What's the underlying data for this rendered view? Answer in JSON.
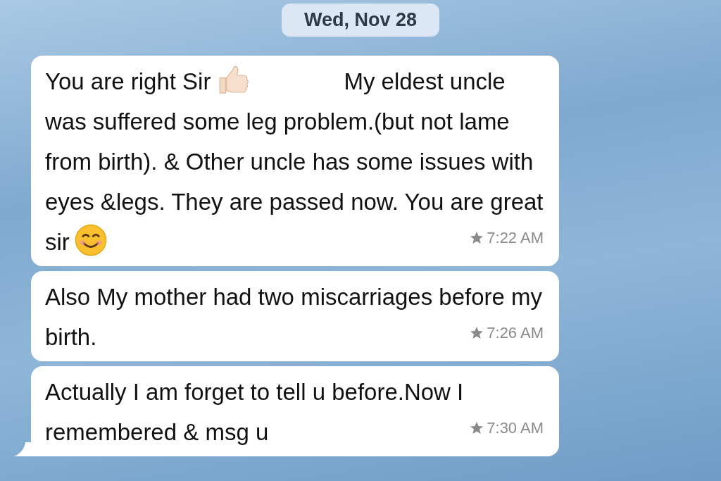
{
  "date_divider": "Wed, Nov 28",
  "messages": [
    {
      "parts": [
        {
          "kind": "text",
          "text": "You are right Sir"
        },
        {
          "kind": "thumbs-up"
        },
        {
          "kind": "text",
          "text": "My eldest uncle was suffered some leg problem.(but not lame from birth). & Other uncle has some issues with eyes &legs. They are passed now. You are great sir"
        },
        {
          "kind": "smiley"
        }
      ],
      "time": "7:22 AM",
      "starred": true,
      "tail": false
    },
    {
      "parts": [
        {
          "kind": "text",
          "text": "Also My mother had two miscarriages before my birth."
        }
      ],
      "time": "7:26 AM",
      "starred": true,
      "tail": false
    },
    {
      "parts": [
        {
          "kind": "text",
          "text": "Actually I am forget to tell u before.Now I remembered & msg u"
        }
      ],
      "time": "7:30 AM",
      "starred": true,
      "tail": true
    }
  ]
}
